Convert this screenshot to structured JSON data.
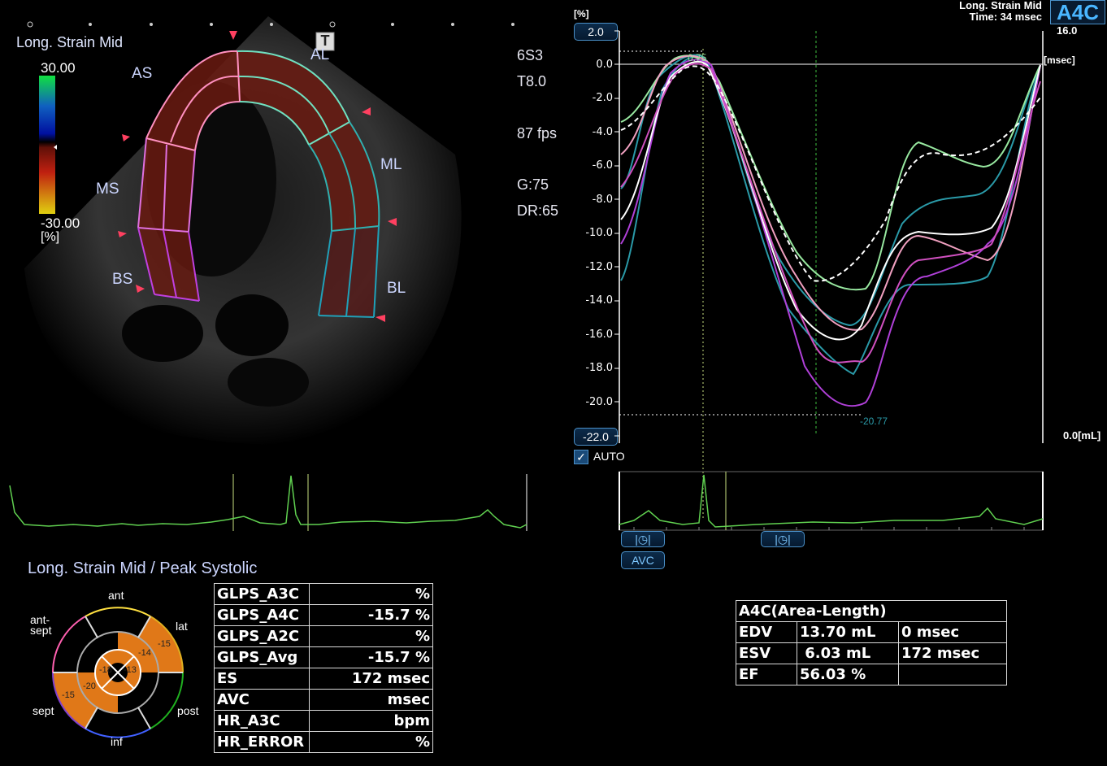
{
  "image_view": {
    "title": "Long. Strain Mid",
    "scale_max": "30.00",
    "scale_min": "-30.00",
    "scale_unit": "[%]",
    "t_marker": "T",
    "segment_labels": {
      "AS": "AS",
      "AL": "AL",
      "MS": "MS",
      "ML": "ML",
      "BS": "BS",
      "BL": "BL"
    },
    "info": [
      "6S3",
      "T8.0",
      "87 fps",
      "G:75",
      "DR:65"
    ]
  },
  "header": {
    "title": "Long. Strain Mid",
    "time": "Time: 34 msec",
    "view_badge": "A4C",
    "vol_max": "16.0",
    "x_unit": "[msec]",
    "vol_zero": "0.0[mL]"
  },
  "graph": {
    "y_unit": "[%]",
    "y_top_button": "2.0",
    "y_bottom_button": "-22.0",
    "y_ticks": [
      "0.0",
      "-2.0",
      "-4.0",
      "-6.0",
      "-8.0",
      "-10.0",
      "-12.0",
      "-14.0",
      "-16.0",
      "-18.0",
      "-20.0"
    ],
    "peak_max_label": "0.75",
    "peak_min_label": "-20.77",
    "auto_label": "AUTO",
    "auto_checked": true,
    "avc_button": "AVC",
    "colors": {
      "green": "#98e8a0",
      "teal": "#2a9aa8",
      "pink": "#f0a0c0",
      "purple": "#b040d8",
      "white": "#ffffff",
      "magenta": "#d050c0"
    }
  },
  "bullseye": {
    "title": "Long. Strain Mid / Peak Systolic",
    "labels": {
      "ant": "ant",
      "ant_sept": "ant-\nsept",
      "lat": "lat",
      "sept": "sept",
      "post": "post",
      "inf": "inf"
    },
    "values": {
      "lat_outer": "-15",
      "lat_inner": "-14",
      "sept_outer": "-15",
      "sept_inner": "-20",
      "apex_left": "-18",
      "apex_right": "-13"
    }
  },
  "glps_table": [
    [
      "GLPS_A3C",
      "%"
    ],
    [
      "GLPS_A4C",
      "-15.7 %"
    ],
    [
      "GLPS_A2C",
      "%"
    ],
    [
      "GLPS_Avg",
      "-15.7 %"
    ],
    [
      "ES",
      "172 msec"
    ],
    [
      "AVC",
      "msec"
    ],
    [
      "HR_A3C",
      "bpm"
    ],
    [
      "HR_ERROR",
      "%"
    ]
  ],
  "volume_table": {
    "title": "A4C(Area-Length)",
    "rows": [
      [
        "EDV",
        "13.70 mL",
        "0 msec"
      ],
      [
        "ESV",
        " 6.03 mL",
        "172 msec"
      ],
      [
        "EF",
        "56.03 %",
        ""
      ]
    ]
  }
}
